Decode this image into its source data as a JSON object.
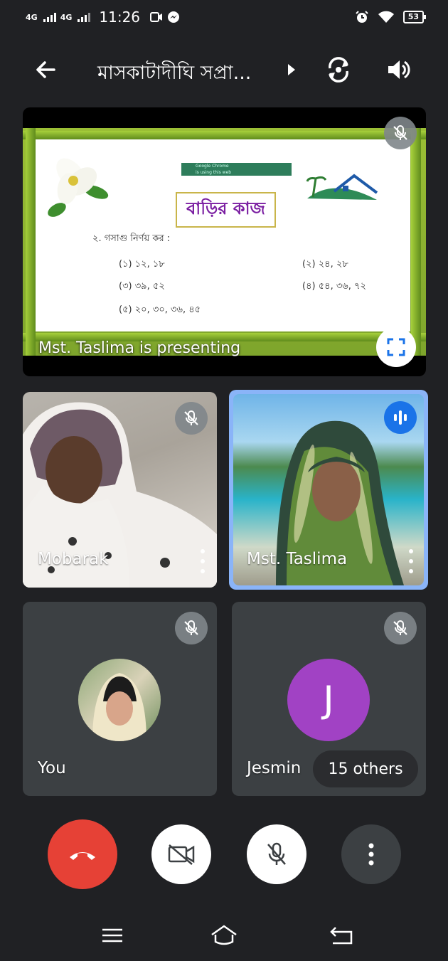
{
  "status_bar": {
    "network1": "4G",
    "network2": "4G",
    "time": "11:26",
    "battery": "53"
  },
  "app_bar": {
    "title": "মাসকাটাদীঘি সপ্রা..."
  },
  "presentation": {
    "slide": {
      "title": "বাড়ির কাজ",
      "question": "২.   গসাগু নির্ণয় কর :",
      "items": [
        "(১)  ১২, ১৮",
        "(২)  ২৪, ২৮",
        "(৩)  ৩৯, ৫২",
        "(৪)  ৫৪, ৩৬, ৭২",
        "(৫)  ২০, ৩০, ৩৬, ৪৫"
      ],
      "chrome_line1": "Google Chrome",
      "chrome_line2": "is using this web"
    },
    "presenting_label": "Mst. Taslima is presenting"
  },
  "participants": [
    {
      "name": "Mobarak"
    },
    {
      "name": "Mst. Taslima"
    },
    {
      "name": "You"
    },
    {
      "name": "Jesmin",
      "initial": "J"
    }
  ],
  "others_chip": "15 others",
  "colors": {
    "background": "#202124",
    "tile": "#3c4043",
    "end_call": "#e64136",
    "speaking": "#1a73e8",
    "avatar_j": "#a142c4"
  }
}
